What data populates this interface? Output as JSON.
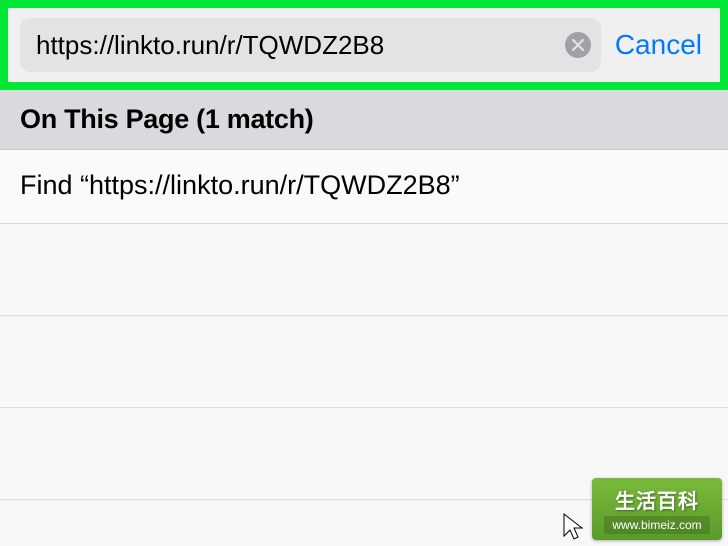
{
  "searchBar": {
    "value": "https://linkto.run/r/TQWDZ2B8",
    "cancelLabel": "Cancel"
  },
  "section": {
    "headerText": "On This Page (1 match)"
  },
  "findRow": {
    "text": "Find “https://linkto.run/r/TQWDZ2B8”"
  },
  "watermark": {
    "brand": "生活百科",
    "url": "www.bimeiz.com"
  }
}
